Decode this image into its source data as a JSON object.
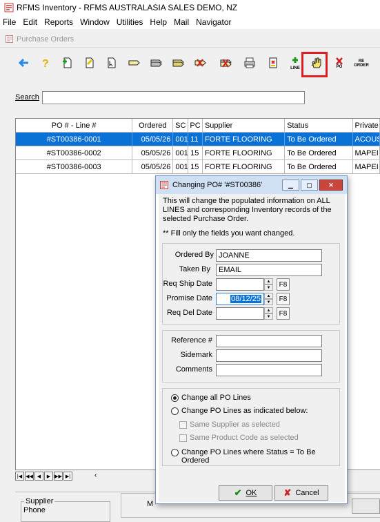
{
  "window": {
    "title": "RFMS Inventory - RFMS AUSTRALASIA SALES DEMO, NZ"
  },
  "menu": [
    "File",
    "Edit",
    "Reports",
    "Window",
    "Utilities",
    "Help",
    "Mail",
    "Navigator"
  ],
  "subwindow": {
    "title": "Purchase Orders"
  },
  "toolbar": {
    "line_label": "LINE",
    "po_label": "PO",
    "reorder_label": "RE ORDER",
    "highlight_color": "#e02020"
  },
  "search": {
    "label": "Search",
    "value": ""
  },
  "grid": {
    "columns": [
      "PO # - Line #",
      "Ordered",
      "SC",
      "PC",
      "Supplier",
      "Status",
      "Private"
    ],
    "rows": [
      {
        "po": "#ST00386-0001",
        "ordered": "05/05/26",
        "sc": "001",
        "pc": "11",
        "supplier": "FORTE FLOORING",
        "status": "To Be Ordered",
        "private": "ACOUS",
        "selected": true
      },
      {
        "po": "#ST00386-0002",
        "ordered": "05/05/26",
        "sc": "001",
        "pc": "15",
        "supplier": "FORTE FLOORING",
        "status": "To Be Ordered",
        "private": "MAPEI",
        "selected": false
      },
      {
        "po": "#ST00386-0003",
        "ordered": "05/05/26",
        "sc": "001",
        "pc": "15",
        "supplier": "FORTE FLOORING",
        "status": "To Be Ordered",
        "private": "MAPEI",
        "selected": false
      }
    ],
    "selection_color": "#0a72d6"
  },
  "bottom": {
    "supplier_legend": "Supplier",
    "phone_label": "Phone",
    "m_label": "M"
  },
  "dialog": {
    "title": "Changing PO# '#ST00386'",
    "message": "This will change the populated information on ALL LINES and corresponding Inventory records of the selected Purchase Order.",
    "note": "** Fill only the fields you want changed.",
    "fields": {
      "ordered_by": {
        "label": "Ordered By",
        "value": "JOANNE"
      },
      "taken_by": {
        "label": "Taken By",
        "value": "EMAIL"
      },
      "req_ship_date": {
        "label": "Req Ship Date",
        "value": ""
      },
      "promise_date": {
        "label": "Promise Date",
        "value": "08/12/25"
      },
      "req_del_date": {
        "label": "Req Del Date",
        "value": ""
      },
      "reference": {
        "label": "Reference #",
        "value": ""
      },
      "sidemark": {
        "label": "Sidemark",
        "value": ""
      },
      "comments": {
        "label": "Comments",
        "value": ""
      }
    },
    "f8_label": "F8",
    "options": {
      "change_all": "Change all PO Lines",
      "change_indicated": "Change PO Lines as indicated below:",
      "same_supplier": "Same Supplier as selected",
      "same_product": "Same Product Code as selected",
      "change_status": "Change  PO Lines where Status = To Be Ordered"
    },
    "ok_label": "OK",
    "cancel_label": "Cancel"
  }
}
